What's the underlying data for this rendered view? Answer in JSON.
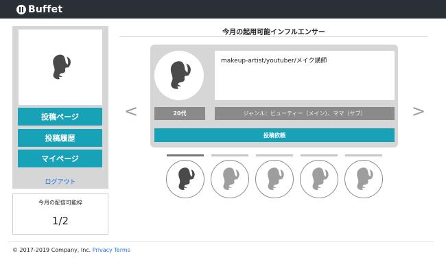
{
  "header": {
    "logo_text": "Buffet",
    "logo_icon": "fork-knife-icon"
  },
  "sidebar": {
    "buttons": [
      {
        "label": "投稿ページ"
      },
      {
        "label": "投稿履歴"
      },
      {
        "label": "マイページ"
      }
    ],
    "logout_label": "ログアウト",
    "quota": {
      "label": "今月の配信可能枠",
      "value": "1/2"
    }
  },
  "main": {
    "title": "今月の起用可能インフルエンサー",
    "card": {
      "bio": "makeup-artist/youtuber/メイク講師",
      "age": "20代",
      "genre": "ジャンル：ビューティー（メイン）、ママ（サブ）",
      "request_label": "投稿依頼"
    },
    "nav": {
      "prev": "<",
      "next": ">"
    },
    "thumbnails": [
      {
        "active": true
      },
      {
        "active": false
      },
      {
        "active": false
      },
      {
        "active": false
      },
      {
        "active": false
      }
    ]
  },
  "footer": {
    "copyright": "© 2017-2019 Company, Inc.",
    "privacy": "Privacy",
    "terms": "Terms"
  },
  "colors": {
    "accent": "#17a2b8",
    "topbar": "#2b2f36",
    "panel": "#d6d6d6",
    "link": "#1a73e8"
  }
}
